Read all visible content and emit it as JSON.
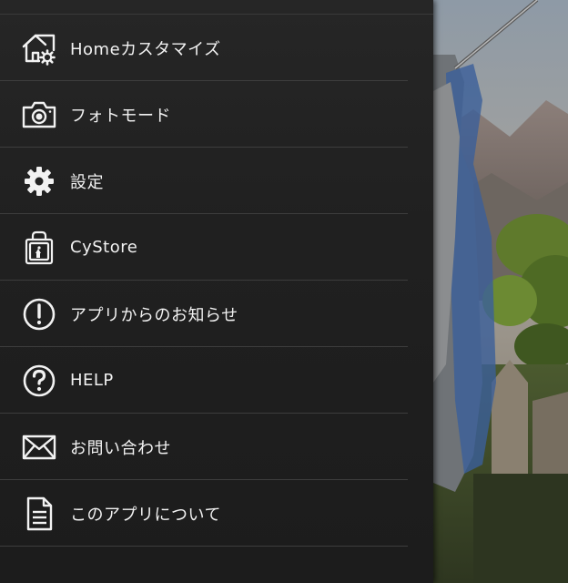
{
  "menu": {
    "items": [
      {
        "label": "Homeカスタマイズ",
        "icon": "home-settings-icon"
      },
      {
        "label": "フォトモード",
        "icon": "camera-icon"
      },
      {
        "label": "設定",
        "icon": "gear-icon"
      },
      {
        "label": "CyStore",
        "icon": "shopping-bag-icon"
      },
      {
        "label": "アプリからのお知らせ",
        "icon": "exclamation-circle-icon"
      },
      {
        "label": "HELP",
        "icon": "question-circle-icon"
      },
      {
        "label": "お問い合わせ",
        "icon": "envelope-icon"
      },
      {
        "label": "このアプリについて",
        "icon": "document-icon"
      }
    ]
  },
  "colors": {
    "drawer_bg": "#222222",
    "text": "#f2f2f2",
    "divider": "#3d3d3d",
    "icon": "#f2f2f2"
  }
}
